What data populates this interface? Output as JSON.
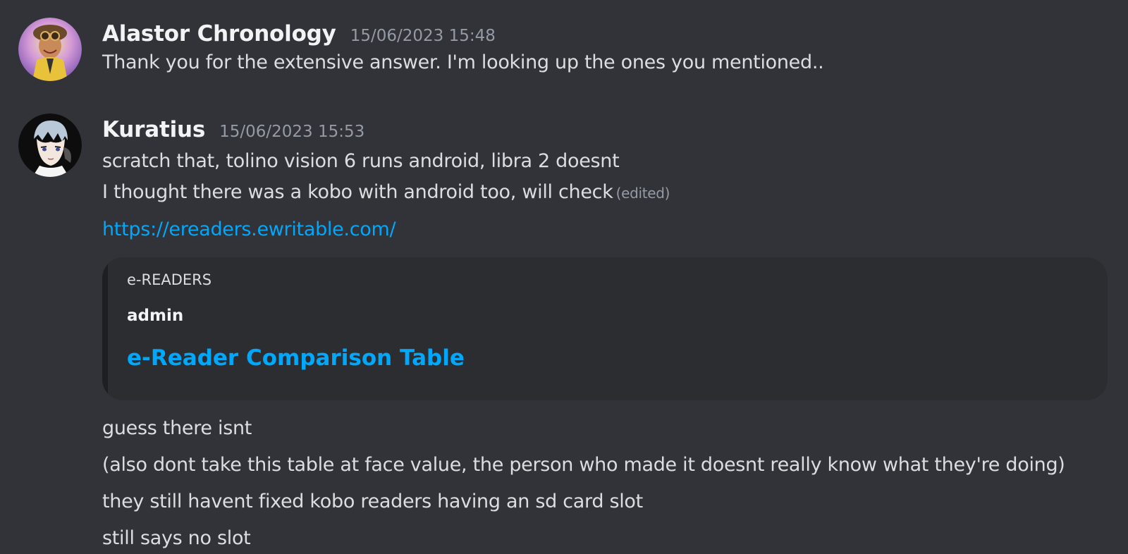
{
  "messages": [
    {
      "author": "Alastor Chronology",
      "timestamp": "15/06/2023 15:48",
      "lines": [
        "Thank you for the extensive answer. I'm looking up the ones you mentioned.."
      ]
    },
    {
      "author": "Kuratius",
      "timestamp": "15/06/2023 15:53",
      "lines": [
        "scratch that, tolino vision 6 runs android, libra 2 doesnt",
        "I thought there was a kobo with android too, will check"
      ],
      "edited_label": "(edited)",
      "link": "https://ereaders.ewritable.com/",
      "embed": {
        "provider": "e-READERS",
        "author": "admin",
        "title": "e-Reader Comparison Table"
      },
      "followups": [
        "guess there isnt",
        "(also dont take this table at face value, the person who made it doesnt really know what they're doing)",
        "they still havent fixed kobo readers having an sd card slot",
        "still says no slot"
      ]
    }
  ]
}
